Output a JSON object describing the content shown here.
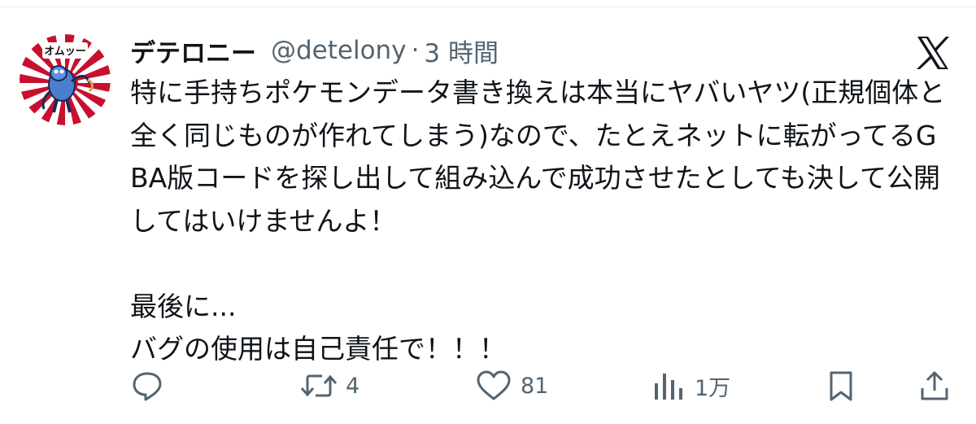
{
  "tweet": {
    "display_name": "デテロニー",
    "handle": "@detelony",
    "separator": "·",
    "time": "3 時間",
    "paragraph_1": "特に手持ちポケモンデータ書き換えは本当にヤバいヤツ(正規個体と全く同じものが作れてしまう)なので、たとえネットに転がってるGBA版コードを探し出して組み込んで成功させたとしても決して公開してはいけませんよ！",
    "paragraph_2_line_1": "最後に...",
    "paragraph_2_line_2": "バグの使用は自己責任で！！！"
  },
  "avatar": {
    "label_text": "オムッー",
    "colors": {
      "ray_red": "#c8102e",
      "ray_white": "#ffffff",
      "character": "#4a7fd0"
    }
  },
  "actions": {
    "reply": {
      "icon": "reply-icon",
      "count": ""
    },
    "retweet": {
      "icon": "retweet-icon",
      "count": "4"
    },
    "like": {
      "icon": "heart-icon",
      "count": "81"
    },
    "views": {
      "icon": "views-icon",
      "count": "1万"
    },
    "bookmark": {
      "icon": "bookmark-icon",
      "count": ""
    },
    "share": {
      "icon": "share-icon",
      "count": ""
    }
  },
  "colors": {
    "text_primary": "#0f1419",
    "text_secondary": "#536471",
    "divider": "#e6ecf0"
  }
}
